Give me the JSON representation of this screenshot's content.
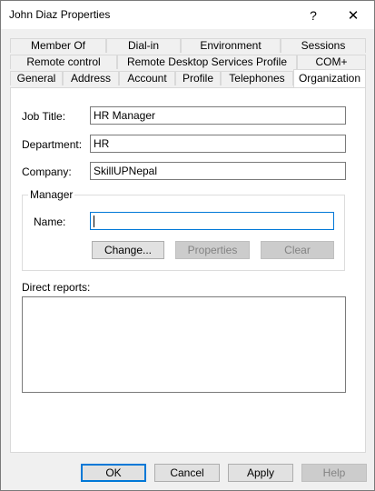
{
  "window": {
    "title": "John Diaz Properties",
    "help_glyph": "?",
    "close_glyph": "✕"
  },
  "tabs": {
    "row1": [
      "Member Of",
      "Dial-in",
      "Environment",
      "Sessions"
    ],
    "row2": [
      "Remote control",
      "Remote Desktop Services Profile",
      "COM+"
    ],
    "row3": [
      "General",
      "Address",
      "Account",
      "Profile",
      "Telephones",
      "Organization"
    ],
    "active": "Organization"
  },
  "form": {
    "job_title_label": "Job Title:",
    "job_title_value": "HR Manager",
    "department_label": "Department:",
    "department_value": "HR",
    "company_label": "Company:",
    "company_value": "SkillUPNepal"
  },
  "manager": {
    "group_label": "Manager",
    "name_label": "Name:",
    "name_value": "",
    "change_label": "Change...",
    "properties_label": "Properties",
    "clear_label": "Clear"
  },
  "direct_reports": {
    "label": "Direct reports:",
    "items": []
  },
  "footer": {
    "ok": "OK",
    "cancel": "Cancel",
    "apply": "Apply",
    "help": "Help"
  }
}
